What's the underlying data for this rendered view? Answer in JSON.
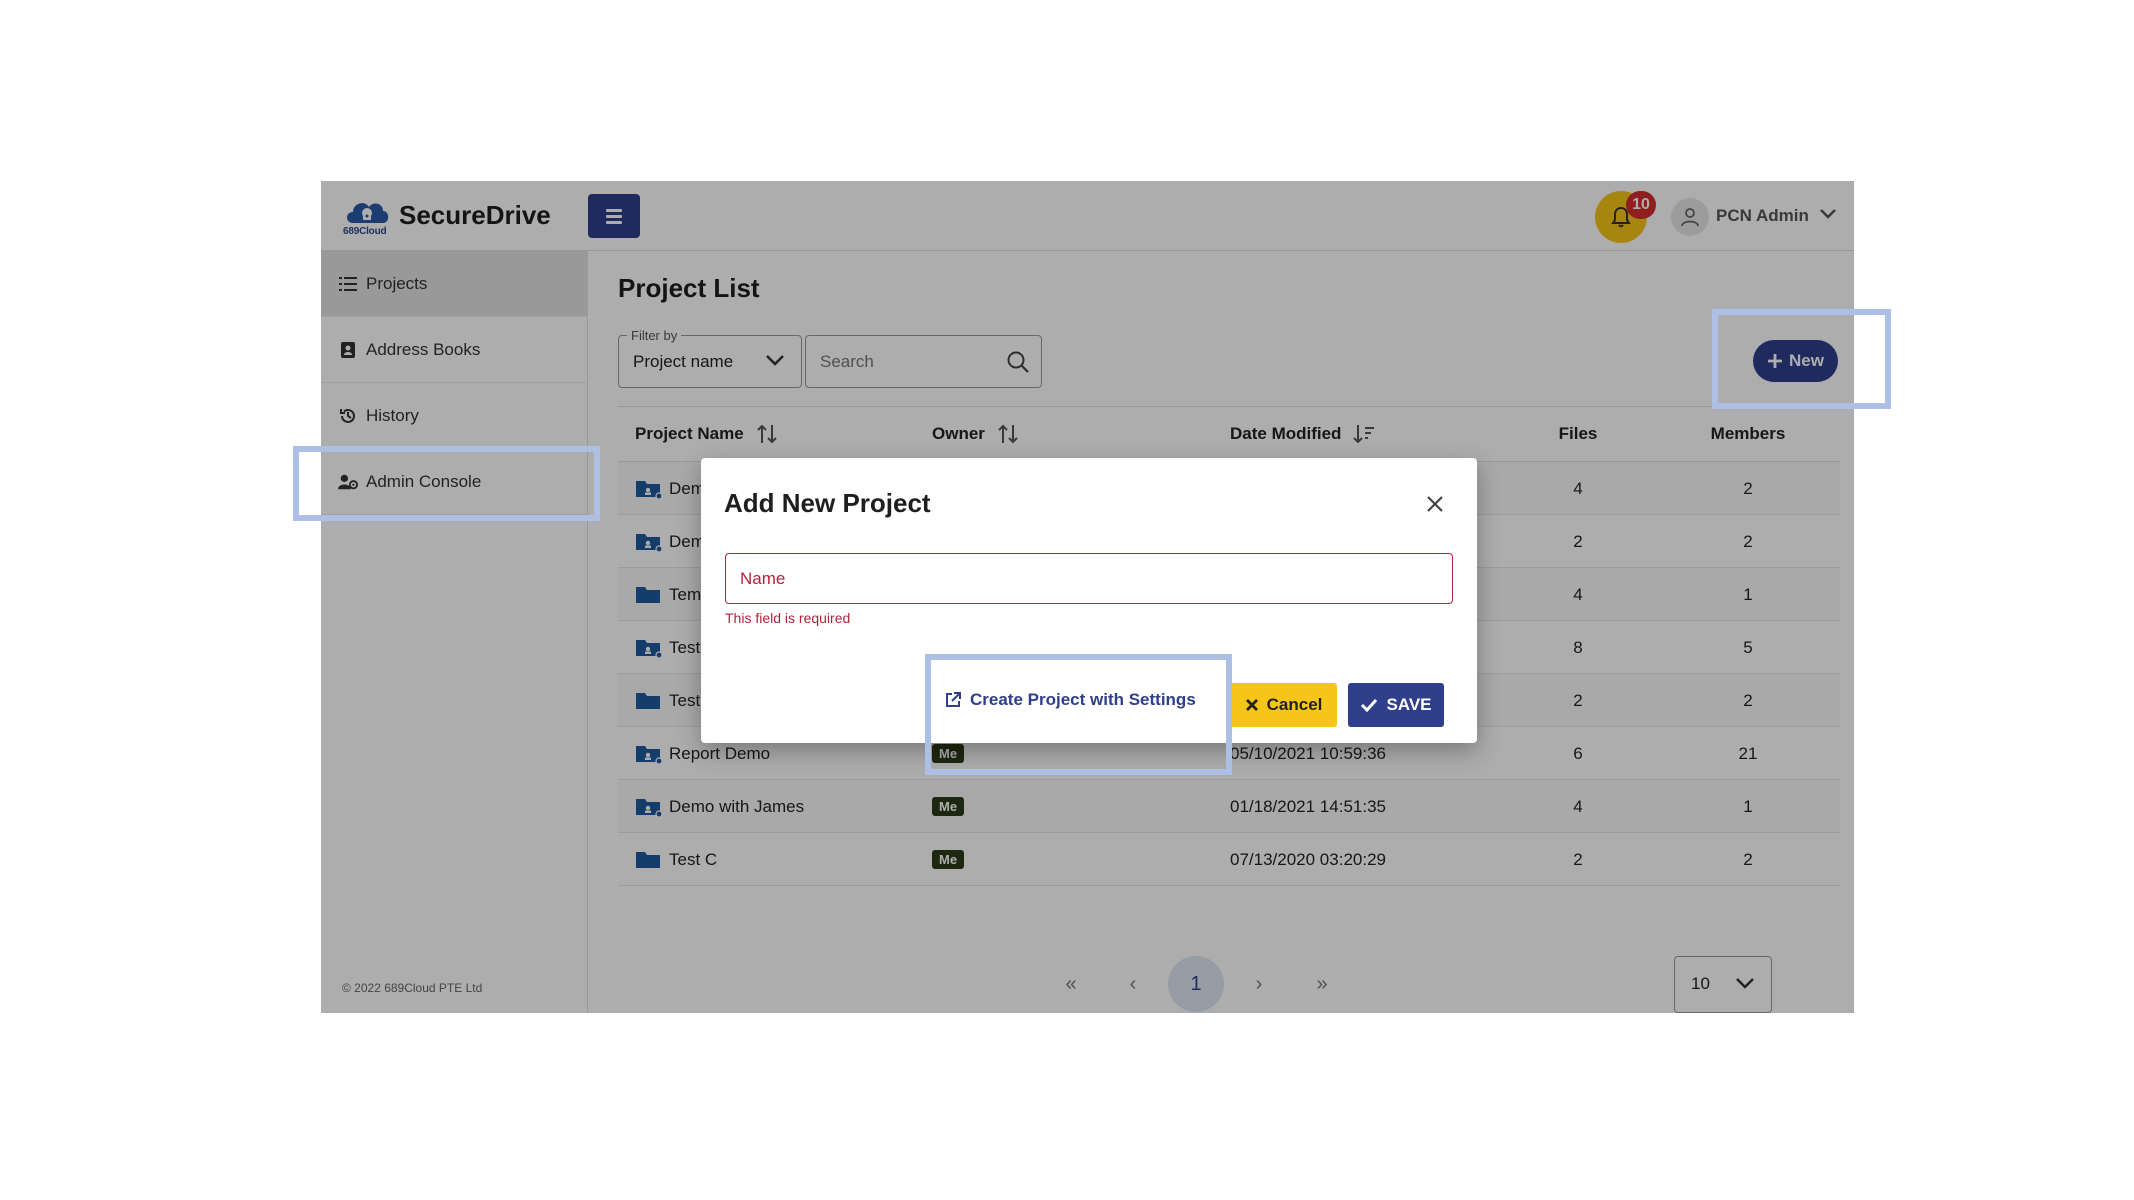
{
  "header": {
    "logo_sub": "689Cloud",
    "brand": "SecureDrive",
    "notification_count": "10",
    "user_name": "PCN Admin",
    "bell_color": "#f5c518",
    "brand_color": "#2f3f8c"
  },
  "sidebar": {
    "items": [
      {
        "label": "Projects",
        "icon": "list-icon"
      },
      {
        "label": "Address Books",
        "icon": "contact-book-icon"
      },
      {
        "label": "History",
        "icon": "history-icon"
      },
      {
        "label": "Admin Console",
        "icon": "admin-user-icon"
      }
    ],
    "copyright": "© 2022 689Cloud PTE Ltd"
  },
  "main": {
    "title": "Project List",
    "filter_label": "Filter by",
    "filter_value": "Project name",
    "search_placeholder": "Search",
    "new_button": "New",
    "columns": [
      "Project Name",
      "Owner",
      "Date Modified",
      "Files",
      "Members"
    ],
    "rows": [
      {
        "name": "Dem",
        "owner": "",
        "date": "",
        "files": "4",
        "members": "2",
        "shared": true
      },
      {
        "name": "Dem",
        "owner": "",
        "date": "",
        "files": "2",
        "members": "2",
        "shared": true
      },
      {
        "name": "Temp",
        "owner": "",
        "date": "",
        "files": "4",
        "members": "1",
        "shared": false
      },
      {
        "name": "Test",
        "owner": "",
        "date": "",
        "files": "8",
        "members": "5",
        "shared": true
      },
      {
        "name": "Test",
        "owner": "",
        "date": "",
        "files": "2",
        "members": "2",
        "shared": false
      },
      {
        "name": "Report Demo",
        "owner": "Me",
        "date": "05/10/2021 10:59:36",
        "files": "6",
        "members": "21",
        "shared": true
      },
      {
        "name": "Demo with James",
        "owner": "Me",
        "date": "01/18/2021 14:51:35",
        "files": "4",
        "members": "1",
        "shared": true
      },
      {
        "name": "Test C",
        "owner": "Me",
        "date": "07/13/2020 03:20:29",
        "files": "2",
        "members": "2",
        "shared": false
      }
    ]
  },
  "pagination": {
    "first": "«",
    "prev": "‹",
    "current": "1",
    "next": "›",
    "last": "»",
    "page_size": "10"
  },
  "modal": {
    "title": "Add New Project",
    "name_placeholder": "Name",
    "error": "This field is required",
    "create_with_settings": "Create Project with Settings",
    "cancel": "Cancel",
    "save": "SAVE",
    "error_color": "#b0243b"
  }
}
